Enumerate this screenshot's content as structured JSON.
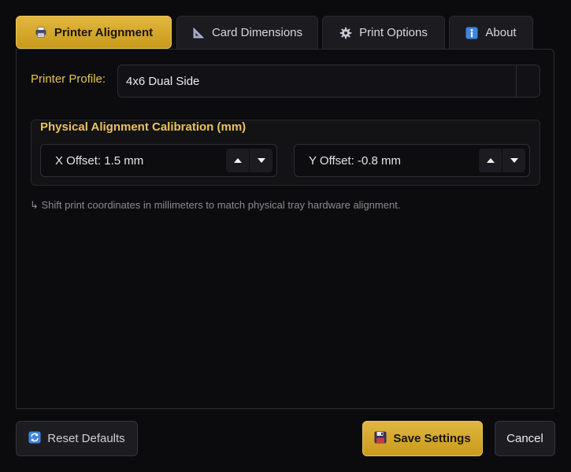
{
  "tabs": [
    {
      "label": "Printer  Alignment",
      "icon": "printer-icon",
      "active": true
    },
    {
      "label": "Card Dimensions",
      "icon": "triangle-ruler-icon",
      "active": false
    },
    {
      "label": "Print Options",
      "icon": "gear-icon",
      "active": false
    },
    {
      "label": "About",
      "icon": "info-icon",
      "active": false
    }
  ],
  "profile": {
    "label": "Printer Profile:",
    "value": "4x6 Dual Side"
  },
  "calibration": {
    "title": "Physical Alignment  Calibration (mm)",
    "x_offset": "X Offset: 1.5 mm",
    "y_offset": "Y Offset: -0.8 mm"
  },
  "hint": "↳ Shift print coordinates in millimeters to match physical tray hardware alignment.",
  "footer": {
    "reset_label": "Reset Defaults",
    "save_label": "Save Settings",
    "cancel_label": "Cancel"
  },
  "colors": {
    "accent": "#d4a82c",
    "background": "#0b0b0d"
  }
}
